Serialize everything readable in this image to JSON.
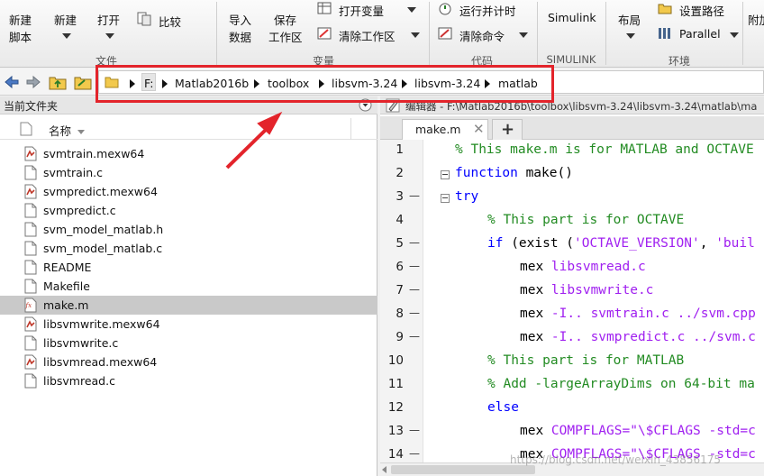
{
  "ribbon": {
    "new_script": "新建\n脚本",
    "new_script_l1": "新建",
    "new_script_l2": "脚本",
    "new": "新建",
    "open": "打开",
    "compare": "比较",
    "file_group": "文件",
    "import_l1": "导入",
    "import_l2": "数据",
    "save_ws_l1": "保存",
    "save_ws_l2": "工作区",
    "open_var": "打开变量",
    "clear_ws": "清除工作区",
    "var_group": "变量",
    "run_time": "运行并计时",
    "clear_cmd": "清除命令",
    "code_group": "代码",
    "simulink": "Simulink",
    "simulink_group": "SIMULINK",
    "layout": "布局",
    "set_path": "设置路径",
    "parallel": "Parallel",
    "env_group": "环境",
    "addons": "附加"
  },
  "address": {
    "drive": "F:",
    "crumbs": [
      "Matlab2016b",
      "toolbox",
      "libsvm-3.24",
      "libsvm-3.24",
      "matlab"
    ]
  },
  "files_panel": {
    "title": "当前文件夹",
    "col_name": "名称",
    "files": [
      {
        "name": "svmtrain.mexw64",
        "type": "mex",
        "selected": false
      },
      {
        "name": "svmtrain.c",
        "type": "c",
        "selected": false
      },
      {
        "name": "svmpredict.mexw64",
        "type": "mex",
        "selected": false
      },
      {
        "name": "svmpredict.c",
        "type": "c",
        "selected": false
      },
      {
        "name": "svm_model_matlab.h",
        "type": "h",
        "selected": false
      },
      {
        "name": "svm_model_matlab.c",
        "type": "c",
        "selected": false
      },
      {
        "name": "README",
        "type": "txt",
        "selected": false
      },
      {
        "name": "Makefile",
        "type": "txt",
        "selected": false
      },
      {
        "name": "make.m",
        "type": "m",
        "selected": true
      },
      {
        "name": "libsvmwrite.mexw64",
        "type": "mex",
        "selected": false
      },
      {
        "name": "libsvmwrite.c",
        "type": "c",
        "selected": false
      },
      {
        "name": "libsvmread.mexw64",
        "type": "mex",
        "selected": false
      },
      {
        "name": "libsvmread.c",
        "type": "c",
        "selected": false
      }
    ]
  },
  "editor": {
    "title": "编辑器 - F:\\Matlab2016b\\toolbox\\libsvm-3.24\\libsvm-3.24\\matlab\\ma",
    "tab_label": "make.m",
    "add_tab": "+",
    "lines": [
      {
        "n": "1",
        "mark": "",
        "fold": false,
        "indent": 0,
        "parts": [
          {
            "c": "cm",
            "t": "% This make.m is for MATLAB and OCTAVE"
          }
        ]
      },
      {
        "n": "2",
        "mark": "",
        "fold": true,
        "indent": 0,
        "parts": [
          {
            "c": "kw",
            "t": "function"
          },
          {
            "c": "pl",
            "t": " make()"
          }
        ]
      },
      {
        "n": "3",
        "mark": "—",
        "fold": true,
        "indent": 0,
        "parts": [
          {
            "c": "kw",
            "t": "try"
          }
        ]
      },
      {
        "n": "4",
        "mark": "",
        "fold": false,
        "indent": 1,
        "parts": [
          {
            "c": "cm",
            "t": "% This part is for OCTAVE"
          }
        ]
      },
      {
        "n": "5",
        "mark": "—",
        "fold": false,
        "indent": 1,
        "parts": [
          {
            "c": "kw",
            "t": "if"
          },
          {
            "c": "pl",
            "t": " (exist ("
          },
          {
            "c": "st",
            "t": "'OCTAVE_VERSION'"
          },
          {
            "c": "pl",
            "t": ", "
          },
          {
            "c": "st",
            "t": "'buil"
          }
        ]
      },
      {
        "n": "6",
        "mark": "—",
        "fold": false,
        "indent": 2,
        "parts": [
          {
            "c": "pl",
            "t": "mex "
          },
          {
            "c": "st",
            "t": "libsvmread.c"
          }
        ]
      },
      {
        "n": "7",
        "mark": "—",
        "fold": false,
        "indent": 2,
        "parts": [
          {
            "c": "pl",
            "t": "mex "
          },
          {
            "c": "st",
            "t": "libsvmwrite.c"
          }
        ]
      },
      {
        "n": "8",
        "mark": "—",
        "fold": false,
        "indent": 2,
        "parts": [
          {
            "c": "pl",
            "t": "mex "
          },
          {
            "c": "st",
            "t": "-I.. svmtrain.c ../svm.cpp"
          }
        ]
      },
      {
        "n": "9",
        "mark": "—",
        "fold": false,
        "indent": 2,
        "parts": [
          {
            "c": "pl",
            "t": "mex "
          },
          {
            "c": "st",
            "t": "-I.. svmpredict.c ../svm.c"
          }
        ]
      },
      {
        "n": "10",
        "mark": "",
        "fold": false,
        "indent": 1,
        "parts": [
          {
            "c": "cm",
            "t": "% This part is for MATLAB"
          }
        ]
      },
      {
        "n": "11",
        "mark": "",
        "fold": false,
        "indent": 1,
        "parts": [
          {
            "c": "cm",
            "t": "% Add -largeArrayDims on 64-bit ma"
          }
        ]
      },
      {
        "n": "12",
        "mark": "",
        "fold": false,
        "indent": 1,
        "parts": [
          {
            "c": "kw",
            "t": "else"
          }
        ]
      },
      {
        "n": "13",
        "mark": "—",
        "fold": false,
        "indent": 2,
        "parts": [
          {
            "c": "pl",
            "t": "mex "
          },
          {
            "c": "st",
            "t": "COMPFLAGS=\"\\$CFLAGS -std=c"
          }
        ]
      },
      {
        "n": "14",
        "mark": "—",
        "fold": false,
        "indent": 2,
        "parts": [
          {
            "c": "pl",
            "t": "mex "
          },
          {
            "c": "st",
            "t": "COMPFLAGS=\"\\$CFLAGS -std=c"
          }
        ]
      }
    ]
  },
  "watermark": "https://blog.csdn.net/weixin_43856175",
  "colors": {
    "highlight_box": "#e3242b",
    "keyword": "#0000ff",
    "comment": "#228b22",
    "string": "#a020f0"
  }
}
